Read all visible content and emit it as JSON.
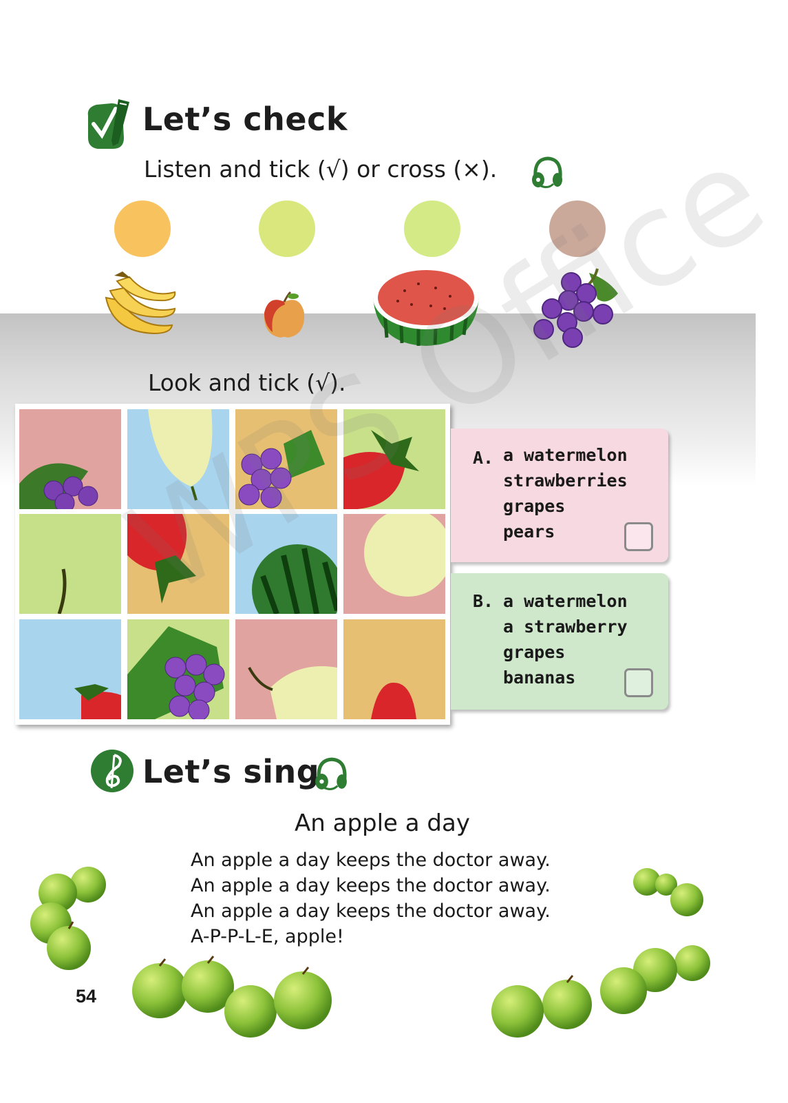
{
  "check": {
    "title": "Let’s check",
    "icon": "check-pencil-icon",
    "listen_instruction": "Listen and tick (√) or cross (×).",
    "listen_icon": "headphones-icon",
    "dot_colors": [
      "#f8c25e",
      "#d9e77c",
      "#d4ea86",
      "#cba99a"
    ],
    "fruits": [
      "bananas-image",
      "apple-image",
      "watermelon-image",
      "grapes-image"
    ],
    "look_instruction": "Look and tick (√)."
  },
  "options": [
    {
      "letter": "A.",
      "items": [
        "a watermelon",
        "strawberries",
        "grapes",
        "pears"
      ],
      "color": "#f7d9e2"
    },
    {
      "letter": "B.",
      "items": [
        "a watermelon",
        "a strawberry",
        "grapes",
        "bananas"
      ],
      "color": "#cfe8cc"
    }
  ],
  "sing": {
    "title": "Let’s sing",
    "icon": "music-note-icon",
    "song_title": "An apple a day",
    "lyrics": [
      "An apple a day keeps the doctor away.",
      "An apple a day keeps the doctor away.",
      "An apple a day keeps the doctor away.",
      "A-P-P-L-E, apple!"
    ]
  },
  "page_number": "54",
  "watermark": "WPS Office"
}
